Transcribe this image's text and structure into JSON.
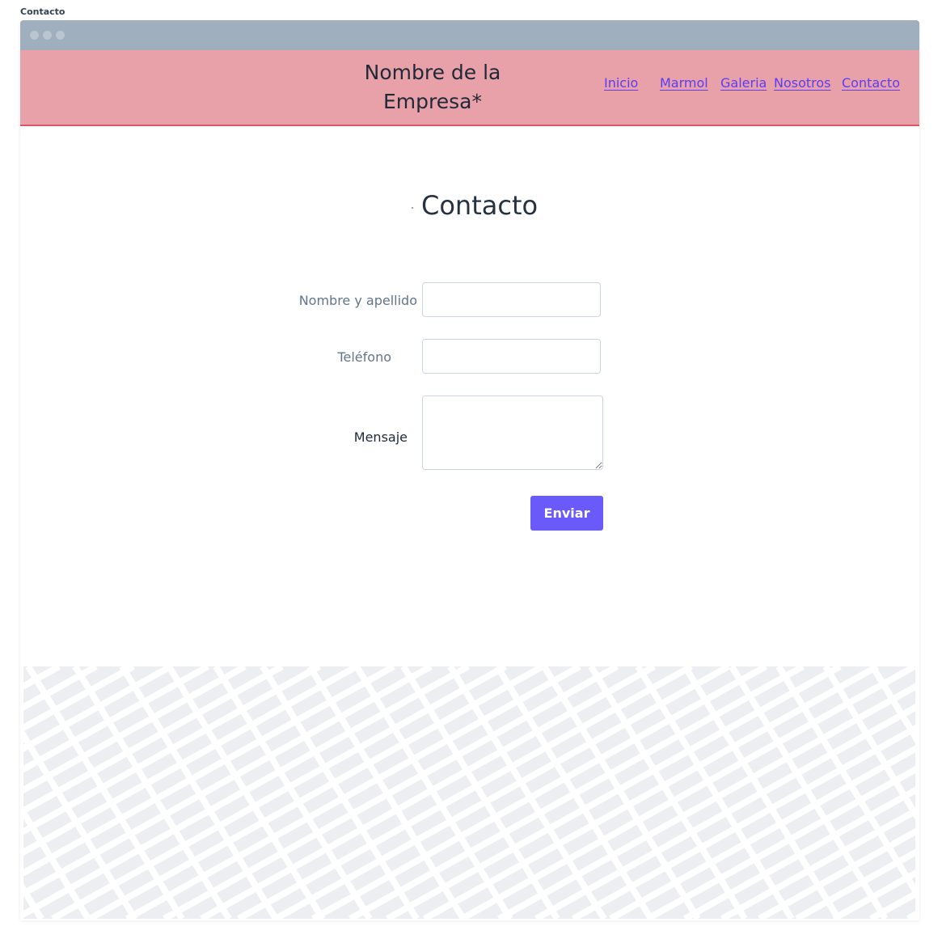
{
  "page": {
    "caption": "Contacto"
  },
  "header": {
    "brand_line1": "Nombre de la",
    "brand_line2": "Empresa*",
    "nav": [
      {
        "label": "Inicio"
      },
      {
        "label": "Marmol"
      },
      {
        "label": "Galeria"
      },
      {
        "label": "Nosotros"
      },
      {
        "label": "Contacto"
      }
    ]
  },
  "main": {
    "title": "Contacto",
    "form": {
      "name_label": "Nombre y apellido",
      "name_value": "",
      "phone_label": "Teléfono",
      "phone_value": "",
      "message_label": "Mensaje",
      "message_value": "",
      "submit_label": "Enviar"
    }
  },
  "colors": {
    "header_bg": "#e8a0a9",
    "header_border": "#e0546a",
    "link": "#5b3df5",
    "button_bg": "#6a5af9",
    "browser_bar": "#9fafbd",
    "map_bg": "#eceef2"
  },
  "icons": [
    "window-dot-icon",
    "textarea-resize-icon"
  ]
}
